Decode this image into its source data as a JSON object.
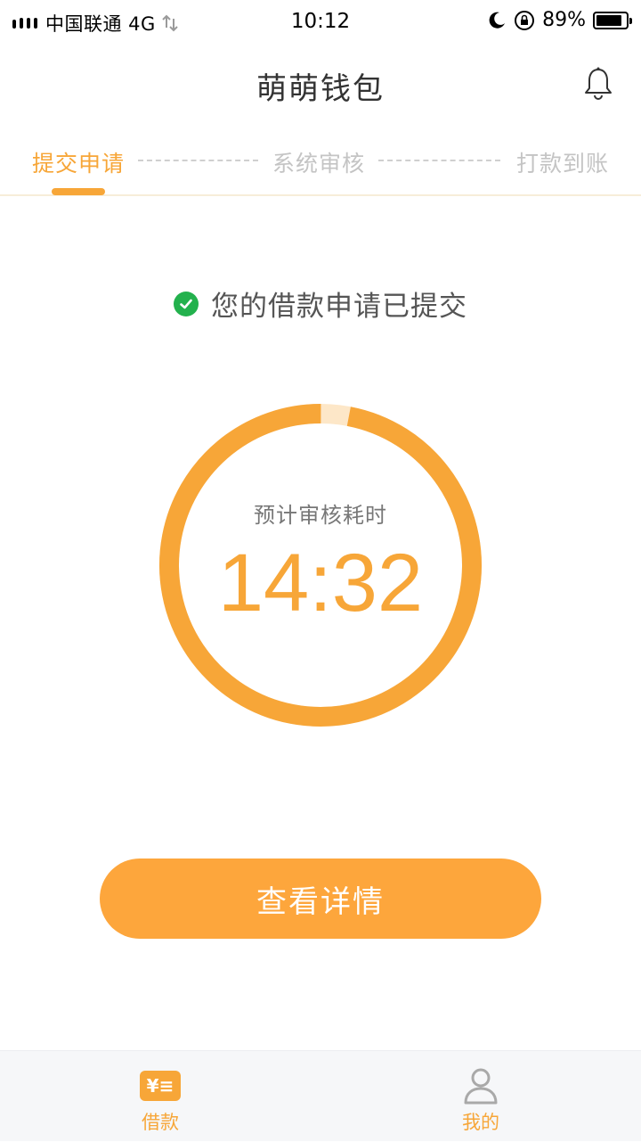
{
  "status_bar": {
    "carrier": "中国联通 4G",
    "time": "10:12",
    "battery": "89%",
    "battery_level": 0.89
  },
  "header": {
    "title": "萌萌钱包",
    "bell_icon": "bell-icon"
  },
  "steps": {
    "items": [
      {
        "label": "提交申请",
        "active": true
      },
      {
        "label": "系统审核",
        "active": false
      },
      {
        "label": "打款到账",
        "active": false
      }
    ]
  },
  "message": {
    "icon": "check-circle-icon",
    "text": "您的借款申请已提交"
  },
  "countdown": {
    "label": "预计审核耗时",
    "time": "14:32",
    "remaining_fraction": 0.97
  },
  "actions": {
    "details_button": "查看详情"
  },
  "bottom_nav": {
    "items": [
      {
        "label": "借款",
        "icon": "wallet-icon",
        "active": true
      },
      {
        "label": "我的",
        "icon": "user-icon",
        "active": false
      }
    ]
  },
  "colors": {
    "accent": "#f7a638",
    "button": "#fda63c",
    "ring_track": "#fde7c8",
    "success": "#23b14d"
  }
}
